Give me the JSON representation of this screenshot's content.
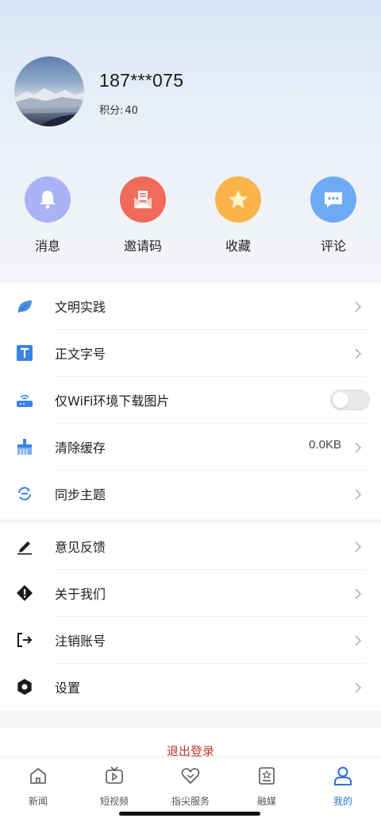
{
  "profile": {
    "username": "187***075",
    "points_label": "积分:",
    "points_value": "40"
  },
  "quick_actions": [
    {
      "label": "消息",
      "icon": "bell-icon",
      "color": "#a9b3f5"
    },
    {
      "label": "邀请码",
      "icon": "mail-icon",
      "color": "#f06b5a"
    },
    {
      "label": "收藏",
      "icon": "star-icon",
      "color": "#fbb44a"
    },
    {
      "label": "评论",
      "icon": "chat-icon",
      "color": "#6ea9f5"
    }
  ],
  "settings_group_1": [
    {
      "label": "文明实践",
      "icon": "leaf-icon"
    },
    {
      "label": "正文字号",
      "icon": "text-size-icon"
    },
    {
      "label": "仅WiFi环境下载图片",
      "icon": "router-icon",
      "toggle": false
    },
    {
      "label": "清除缓存",
      "icon": "broom-icon",
      "value": "0.0KB"
    },
    {
      "label": "同步主题",
      "icon": "sync-icon"
    }
  ],
  "settings_group_2": [
    {
      "label": "意见反馈",
      "icon": "edit-icon"
    },
    {
      "label": "关于我们",
      "icon": "info-icon"
    },
    {
      "label": "注销账号",
      "icon": "exit-icon"
    },
    {
      "label": "设置",
      "icon": "gear-icon"
    }
  ],
  "logout_label": "退出登录",
  "tabs": [
    {
      "label": "新闻",
      "icon": "home-icon"
    },
    {
      "label": "短视频",
      "icon": "tv-icon"
    },
    {
      "label": "指尖服务",
      "icon": "heart-icon"
    },
    {
      "label": "融媒",
      "icon": "media-icon"
    },
    {
      "label": "我的",
      "icon": "user-icon",
      "active": true
    }
  ],
  "colors": {
    "accent": "#2f6fd6",
    "logout": "#c0392b"
  }
}
